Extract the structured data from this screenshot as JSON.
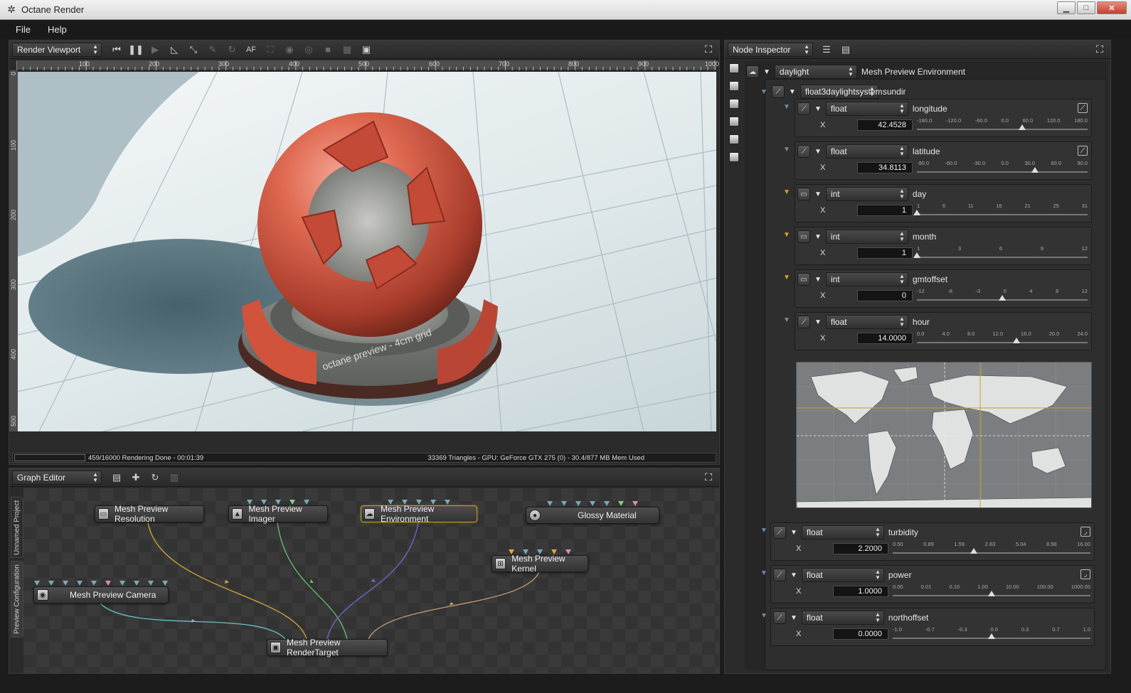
{
  "window": {
    "title": "Octane Render",
    "controls": {
      "minimize": "▁",
      "maximize": "□",
      "close": "✕"
    }
  },
  "menu": {
    "file": "File",
    "help": "Help"
  },
  "viewport": {
    "panel_label": "Render Viewport",
    "ruler_h": [
      "100",
      "200",
      "300",
      "400",
      "500",
      "600",
      "700",
      "800",
      "900",
      "1000"
    ],
    "ruler_v": [
      "0",
      "100",
      "200",
      "300",
      "400",
      "500"
    ],
    "scene_text": "octane preview - 4cm grid",
    "status_left": "459/16000 Rendering Done - 00:01:39",
    "status_right": "33369 Triangles - GPU: GeForce GTX 275 (0) - 30.4/877 MB Mem Used",
    "toolbar": {
      "af": "AF"
    }
  },
  "graph": {
    "panel_label": "Graph Editor",
    "tabs": {
      "project": "Unnamed Project",
      "preview": "Preview Configuration"
    },
    "nodes": {
      "resolution": "Mesh Preview Resolution",
      "imager": "Mesh Preview Imager",
      "environment": "Mesh Preview Environment",
      "glossy": "Glossy Material",
      "kernel": "Mesh Preview Kernel",
      "camera": "Mesh Preview Camera",
      "rendertarget": "Mesh Preview RenderTarget"
    }
  },
  "inspector": {
    "panel_label": "Node Inspector",
    "root": {
      "type": "daylight",
      "name": "Mesh Preview Environment"
    },
    "sundir": {
      "type": "float3daylightsystem",
      "name": "sundir"
    },
    "params": [
      {
        "type": "float",
        "name": "longitude",
        "axis": "X",
        "value": "42.4528",
        "ticks": [
          "-180.0",
          "-120.0",
          "-60.0",
          "0.0",
          "60.0",
          "120.0",
          "180.0"
        ],
        "pos": 0.618
      },
      {
        "type": "float",
        "name": "latitude",
        "axis": "X",
        "value": "34.8113",
        "ticks": [
          "-90.0",
          "-60.0",
          "-30.0",
          "0.0",
          "30.0",
          "60.0",
          "90.0"
        ],
        "pos": 0.693
      },
      {
        "type": "int",
        "name": "day",
        "axis": "X",
        "value": "1",
        "ticks": [
          "1",
          "6",
          "11",
          "16",
          "21",
          "25",
          "31"
        ],
        "pos": 0.0
      },
      {
        "type": "int",
        "name": "month",
        "axis": "X",
        "value": "1",
        "ticks": [
          "1",
          "3",
          "6",
          "9",
          "12"
        ],
        "pos": 0.0
      },
      {
        "type": "int",
        "name": "gmtoffset",
        "axis": "X",
        "value": "0",
        "ticks": [
          "-12",
          "-8",
          "-3",
          "0",
          "4",
          "8",
          "12"
        ],
        "pos": 0.5
      },
      {
        "type": "float",
        "name": "hour",
        "axis": "X",
        "value": "14.0000",
        "ticks": [
          "0.0",
          "4.0",
          "8.0",
          "12.0",
          "16.0",
          "20.0",
          "24.0"
        ],
        "pos": 0.583
      }
    ],
    "lower": [
      {
        "type": "float",
        "name": "turbidity",
        "axis": "X",
        "value": "2.2000",
        "ticks": [
          "0.50",
          "0.89",
          "1.59",
          "2.83",
          "5.04",
          "8.98",
          "16.00"
        ],
        "pos": 0.41
      },
      {
        "type": "float",
        "name": "power",
        "axis": "X",
        "value": "1.0000",
        "ticks": [
          "0.00",
          "0.01",
          "0.10",
          "1.00",
          "10.00",
          "100.00",
          "1000.00"
        ],
        "pos": 0.5
      },
      {
        "type": "float",
        "name": "northoffset",
        "axis": "X",
        "value": "0.0000",
        "ticks": [
          "-1.0",
          "-0.7",
          "-0.3",
          "0.0",
          "0.3",
          "0.7",
          "1.0"
        ],
        "pos": 0.5
      }
    ]
  }
}
